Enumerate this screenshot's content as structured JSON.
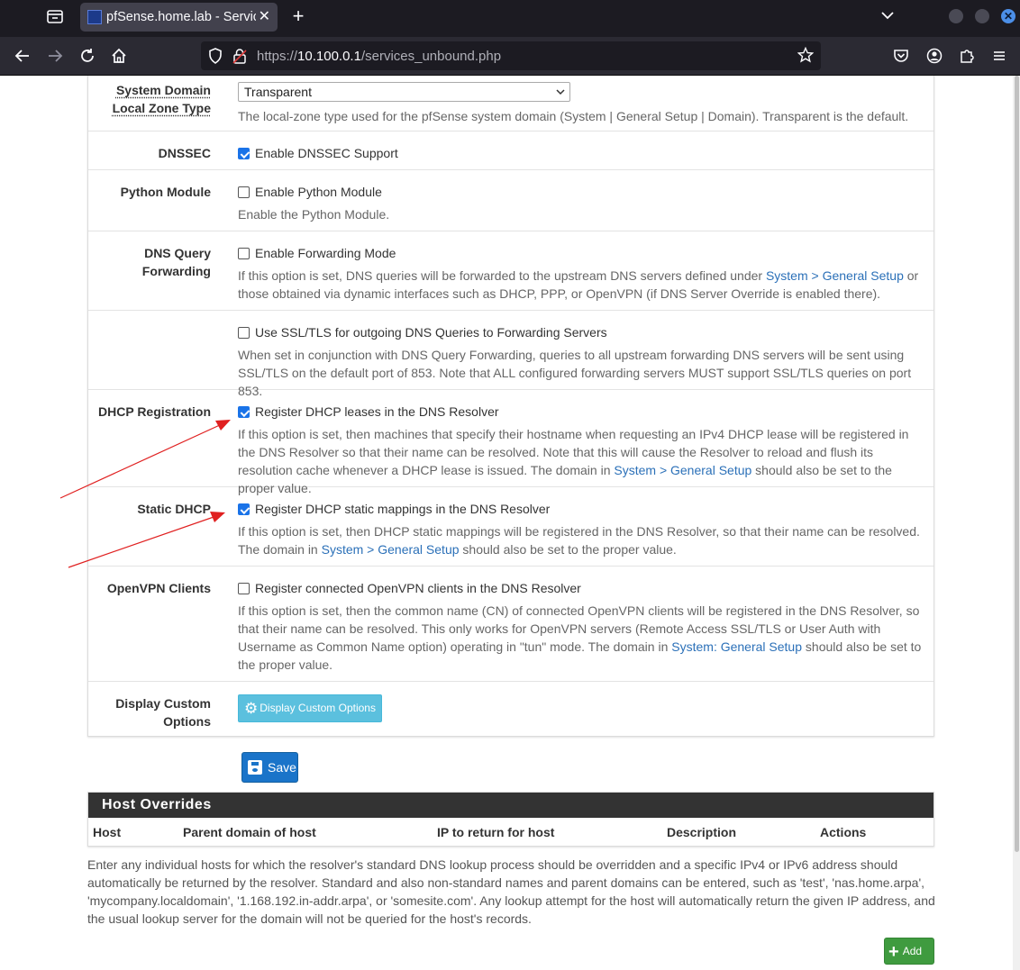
{
  "browser": {
    "tab_title": "pfSense.home.lab - Servic",
    "tab_close": "✕",
    "url_prefix": "https://",
    "url_host": "10.100.0.1",
    "url_path": "/services_unbound.php"
  },
  "settings": {
    "local_zone": {
      "label_line1": "System Domain",
      "label_line2": "Local Zone Type",
      "selected": "Transparent",
      "help": "The local-zone type used for the pfSense system domain (System | General Setup | Domain). Transparent is the default."
    },
    "dnssec": {
      "label": "DNSSEC",
      "checkbox_label": "Enable DNSSEC Support",
      "checked": true
    },
    "python": {
      "label": "Python Module",
      "checkbox_label": "Enable Python Module",
      "checked": false,
      "help": "Enable the Python Module."
    },
    "forwarding": {
      "label_line1": "DNS Query",
      "label_line2": "Forwarding",
      "checkbox_label": "Enable Forwarding Mode",
      "checked": false,
      "help_a": "If this option is set, DNS queries will be forwarded to the upstream DNS servers defined under ",
      "help_link": "System > General Setup",
      "help_b": " or those obtained via dynamic interfaces such as DHCP, PPP, or OpenVPN (if DNS Server Override is enabled there)."
    },
    "ssl_tls": {
      "checkbox_label": "Use SSL/TLS for outgoing DNS Queries to Forwarding Servers",
      "checked": false,
      "help": "When set in conjunction with DNS Query Forwarding, queries to all upstream forwarding DNS servers will be sent using SSL/TLS on the default port of 853. Note that ALL configured forwarding servers MUST support SSL/TLS queries on port 853."
    },
    "dhcp_registration": {
      "label": "DHCP Registration",
      "checkbox_label": "Register DHCP leases in the DNS Resolver",
      "checked": true,
      "help_a": "If this option is set, then machines that specify their hostname when requesting an IPv4 DHCP lease will be registered in the DNS Resolver so that their name can be resolved. Note that this will cause the Resolver to reload and flush its resolution cache whenever a DHCP lease is issued. The domain in ",
      "help_link": "System > General Setup",
      "help_b": " should also be set to the proper value."
    },
    "static_dhcp": {
      "label": "Static DHCP",
      "checkbox_label": "Register DHCP static mappings in the DNS Resolver",
      "checked": true,
      "help_a": "If this option is set, then DHCP static mappings will be registered in the DNS Resolver, so that their name can be resolved. The domain in ",
      "help_link": "System > General Setup",
      "help_b": " should also be set to the proper value."
    },
    "openvpn": {
      "label": "OpenVPN Clients",
      "checkbox_label": "Register connected OpenVPN clients in the DNS Resolver",
      "checked": false,
      "help_a": "If this option is set, then the common name (CN) of connected OpenVPN clients will be registered in the DNS Resolver, so that their name can be resolved. This only works for OpenVPN servers (Remote Access SSL/TLS or User Auth with Username as Common Name option) operating in \"tun\" mode. The domain in ",
      "help_link": "System: General Setup",
      "help_b": " should also be set to the proper value."
    },
    "custom": {
      "label_line1": "Display Custom",
      "label_line2": "Options",
      "button": "Display Custom Options"
    }
  },
  "save_button": "Save",
  "host_overrides": {
    "title": "Host Overrides",
    "columns": [
      "Host",
      "Parent domain of host",
      "IP to return for host",
      "Description",
      "Actions"
    ],
    "description": "Enter any individual hosts for which the resolver's standard DNS lookup process should be overridden and a specific IPv4 or IPv6 address should automatically be returned by the resolver. Standard and also non-standard names and parent domains can be entered, such as 'test', 'nas.home.arpa', 'mycompany.localdomain', '1.168.192.in-addr.arpa', or 'somesite.com'. Any lookup attempt for the host will automatically return the given IP address, and the usual lookup server for the domain will not be queried for the host's records.",
    "add_button": "Add"
  },
  "colors": {
    "link": "#2b70b8",
    "checkbox": "#1a73e8",
    "save": "#1a74c9",
    "add": "#3f9b3f",
    "info": "#5bc0de",
    "arrow": "#e02020"
  }
}
